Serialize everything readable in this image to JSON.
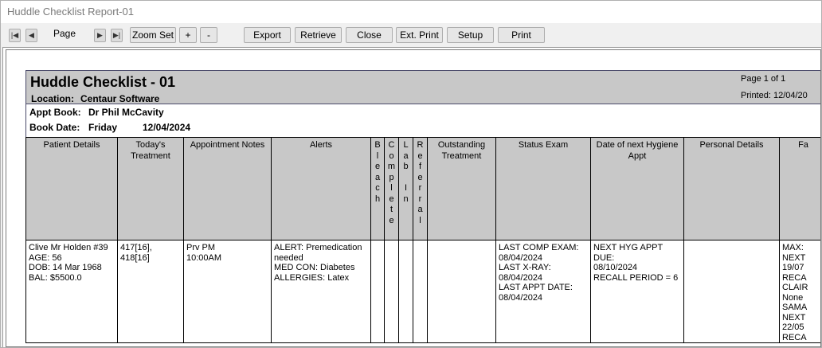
{
  "window": {
    "title": "Huddle Checklist Report-01"
  },
  "toolbar": {
    "page_label": "Page",
    "zoom_set": "Zoom Set",
    "zoom_in": "+",
    "zoom_out": "-",
    "export": "Export",
    "retrieve": "Retrieve",
    "close": "Close",
    "ext_print": "Ext. Print",
    "setup": "Setup",
    "print": "Print"
  },
  "report": {
    "title": "Huddle Checklist - 01",
    "location_label": "Location:",
    "location_value": "Centaur Software",
    "page_text": "Page 1 of 1",
    "printed_text": "Printed: 12/04/20",
    "appt_book_label": "Appt Book:",
    "appt_book_value": "Dr Phil McCavity",
    "book_date_label": "Book Date:",
    "book_date_day": "Friday",
    "book_date_value": "12/04/2024"
  },
  "columns": [
    {
      "key": "patient",
      "label": "Patient Details"
    },
    {
      "key": "treatment",
      "label": "Today's\nTreatment"
    },
    {
      "key": "appt_notes",
      "label": "Appointment Notes"
    },
    {
      "key": "alerts",
      "label": "Alerts"
    },
    {
      "key": "bleach",
      "label": "B\nl\ne\na\nc\nh"
    },
    {
      "key": "complete",
      "label": "C\no\nm\np\nl\ne\nt\ne"
    },
    {
      "key": "lab_in",
      "label": "L\na\nb\n\nI\nn"
    },
    {
      "key": "referral",
      "label": "R\ne\nf\ne\nr\nr\na\nl"
    },
    {
      "key": "outstanding",
      "label": "Outstanding\nTreatment"
    },
    {
      "key": "status_exam",
      "label": "Status Exam"
    },
    {
      "key": "next_hygiene",
      "label": "Date of next Hygiene\nAppt"
    },
    {
      "key": "personal",
      "label": "Personal Details"
    },
    {
      "key": "fa",
      "label": "Fa"
    }
  ],
  "row": {
    "patient": "Clive Mr Holden #39\nAGE:          56\nDOB: 14 Mar 1968\nBAL: $5500.0",
    "treatment": "417[16], 418[16]",
    "appt_notes": "Prv PM\n10:00AM",
    "alerts": "ALERT: Premedication\nneeded\nMED CON: Diabetes\nALLERGIES: Latex",
    "bleach": "",
    "complete": "",
    "lab_in": "",
    "referral": "",
    "outstanding": "",
    "status_exam": "LAST COMP EXAM:\n08/04/2024\nLAST X-RAY:\n08/04/2024\nLAST APPT DATE:\n08/04/2024",
    "next_hygiene": "NEXT HYG APPT DUE:\n08/10/2024\nRECALL PERIOD = 6",
    "personal": "",
    "fa": "MAX:\nNEXT\n19/07\nRECA\nCLAIR\nNone\nSAMA\nNEXT\n22/05\nRECA"
  }
}
